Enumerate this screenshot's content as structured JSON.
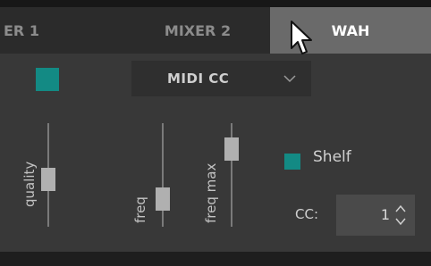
{
  "tabs": [
    {
      "label": "ER 1",
      "active": false
    },
    {
      "label": "MIXER 2",
      "active": false
    },
    {
      "label": "WAH",
      "active": true
    }
  ],
  "midi": {
    "enabled": true,
    "mode_value": "MIDI CC",
    "options_icon": "chevron-down-icon"
  },
  "sliders": [
    {
      "label": "quality",
      "value_fraction": 0.55
    },
    {
      "label": "freq",
      "value_fraction": 0.3
    },
    {
      "label": "freq max",
      "value_fraction": 0.78
    }
  ],
  "shelf": {
    "label": "Shelf",
    "checked": true
  },
  "cc": {
    "label": "CC:",
    "value": "1"
  },
  "colors": {
    "accent": "#138a84",
    "panel": "#383838",
    "active_tab": "#6a6a6a"
  }
}
